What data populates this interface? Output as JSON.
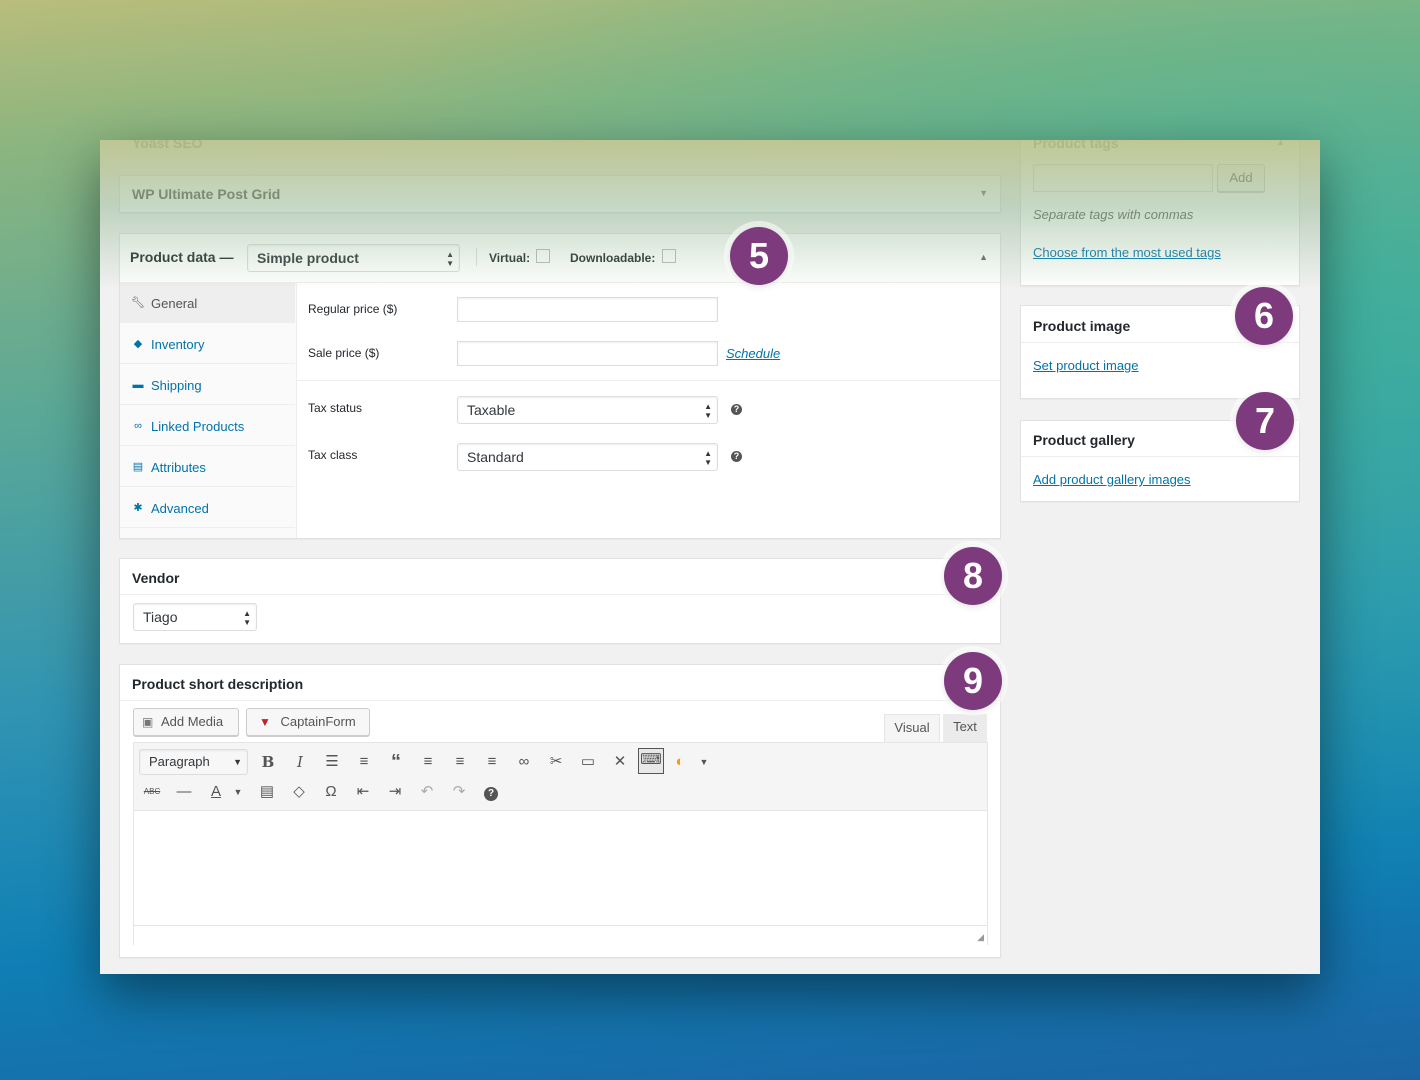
{
  "faded": {
    "left_title": "Yoast SEO",
    "right_title": "Product tags",
    "tag_add_label": "Add",
    "tags_hint": "Separate tags with commas",
    "tags_link": "Choose from the most used tags"
  },
  "wp_grid": {
    "title": "WP Ultimate Post Grid"
  },
  "product_data": {
    "title": "Product data —",
    "type_value": "Simple product",
    "virtual_label": "Virtual:",
    "downloadable_label": "Downloadable:",
    "tabs": [
      {
        "label": "General",
        "icon": "wrench-icon"
      },
      {
        "label": "Inventory",
        "icon": "tag-icon"
      },
      {
        "label": "Shipping",
        "icon": "truck-icon"
      },
      {
        "label": "Linked Products",
        "icon": "link-icon"
      },
      {
        "label": "Attributes",
        "icon": "list-icon"
      },
      {
        "label": "Advanced",
        "icon": "gear-icon"
      }
    ],
    "regular_price_label": "Regular price ($)",
    "sale_price_label": "Sale price ($)",
    "schedule_link": "Schedule",
    "tax_status_label": "Tax status",
    "tax_status_value": "Taxable",
    "tax_class_label": "Tax class",
    "tax_class_value": "Standard",
    "help_glyph": "?"
  },
  "product_image": {
    "title": "Product image",
    "link": "Set product image"
  },
  "product_gallery": {
    "title": "Product gallery",
    "link": "Add product gallery images"
  },
  "vendor": {
    "title": "Vendor",
    "value": "Tiago"
  },
  "short_desc": {
    "title": "Product short description",
    "add_media": "Add Media",
    "captainform": "CaptainForm",
    "tab_visual": "Visual",
    "tab_text": "Text",
    "format_value": "Paragraph",
    "toolbar_row1": [
      "bold-icon",
      "italic-icon",
      "bullet-list-icon",
      "numbered-list-icon",
      "blockquote-icon",
      "align-left-icon",
      "align-center-icon",
      "align-right-icon",
      "link-icon",
      "unlink-icon",
      "read-more-icon",
      "fullscreen-icon",
      "keyboard-icon",
      "captainform-toolbar-icon",
      "dropdown-icon"
    ],
    "toolbar_row2": [
      "strikethrough-icon",
      "horizontal-line-icon",
      "text-color-icon",
      "paste-text-icon",
      "clear-format-icon",
      "omega-icon",
      "outdent-icon",
      "indent-icon",
      "undo-icon",
      "redo-icon",
      "help-icon"
    ]
  },
  "badges": [
    "5",
    "6",
    "7",
    "8",
    "9"
  ],
  "colors": {
    "badge": "#7d3b7e",
    "link": "#0073aa"
  }
}
